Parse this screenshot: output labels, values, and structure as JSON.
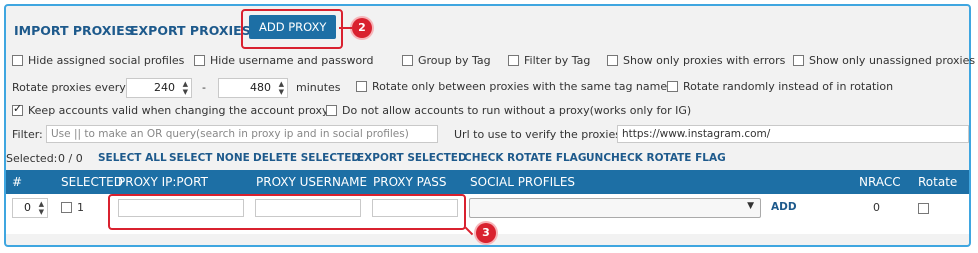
{
  "top": {
    "import_label": "IMPORT PROXIES",
    "export_label": "EXPORT PROXIES",
    "add_label": "ADD PROXY",
    "callout_add": "2",
    "callout_row": "3"
  },
  "options_row1": [
    {
      "label": "Hide assigned social profiles",
      "checked": false
    },
    {
      "label": "Hide username and password",
      "checked": false
    },
    {
      "label": "Group by Tag",
      "checked": false
    },
    {
      "label": "Filter by Tag",
      "checked": false
    },
    {
      "label": "Show only proxies with errors",
      "checked": false
    },
    {
      "label": "Show only unassigned proxies",
      "checked": false
    }
  ],
  "rotate": {
    "label": "Rotate proxies every",
    "min_value": "240",
    "dash": "-",
    "max_value": "480",
    "unit": "minutes",
    "same_tag_label": "Rotate only between proxies with the same tag name",
    "random_label": "Rotate randomly instead of in rotation"
  },
  "options_row3": [
    {
      "label": "Keep accounts valid when changing the account proxy",
      "checked": true
    },
    {
      "label": "Do not allow accounts to run without a proxy(works only for IG)",
      "checked": false
    }
  ],
  "filter": {
    "label": "Filter:",
    "placeholder": "Use || to make an OR query(search in proxy ip and in social profiles)",
    "verify_label": "Url to use to verify the proxies",
    "verify_value": "https://www.instagram.com/"
  },
  "selection": {
    "label": "Selected:",
    "count": "0 / 0",
    "actions": [
      "SELECT ALL",
      "SELECT NONE",
      "DELETE SELECTED",
      "EXPORT SELECTED",
      "CHECK ROTATE FLAG",
      "UNCHECK ROTATE FLAG"
    ]
  },
  "table": {
    "headers": [
      "#",
      "SELECTED",
      "PROXY IP:PORT",
      "PROXY USERNAME",
      "PROXY PASS",
      "SOCIAL PROFILES",
      "NRACC",
      "Rotate"
    ],
    "row": {
      "index": "0",
      "selected_num": "1",
      "add_label": "ADD",
      "nracc": "0"
    }
  },
  "colors": {
    "accent": "#1d6fa5",
    "border": "#3fa6e0",
    "callout": "#d9212f"
  }
}
